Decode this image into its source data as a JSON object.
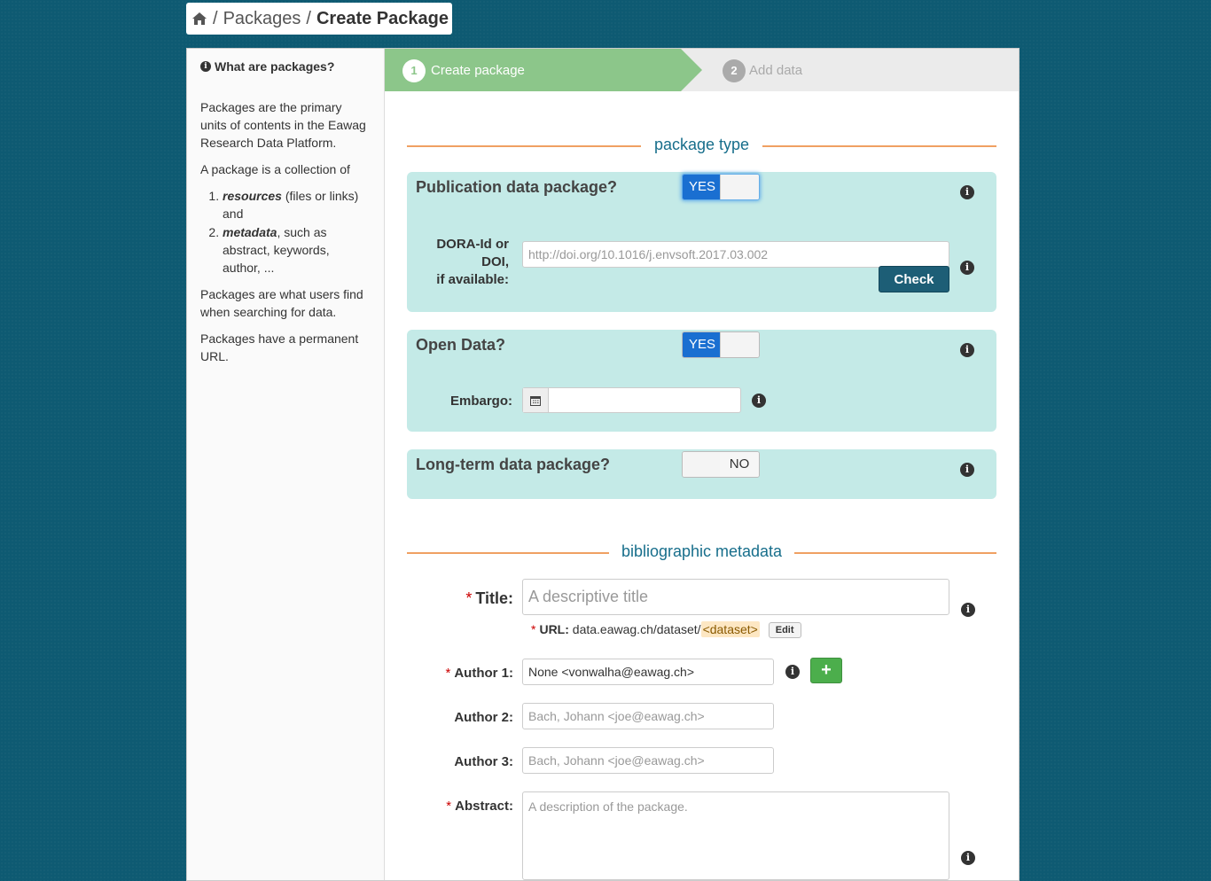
{
  "breadcrumb": {
    "home_icon": "home-icon",
    "sep": "/",
    "packages": "Packages",
    "current": "Create Package"
  },
  "sidebar": {
    "title": "What are packages?",
    "p1": "Packages are the primary units of contents in the Eawag Research Data Platform.",
    "p2": "A package is a collection of",
    "item1_em": "resources",
    "item1_rest": " (files or links) and",
    "item2_em": "metadata",
    "item2_rest": ", such as abstract, keywords, author, ...",
    "p3": "Packages are what users find when searching for data.",
    "p4": "Packages have a permanent URL."
  },
  "stages": {
    "s1_num": "1",
    "s1_label": "Create package",
    "s2_num": "2",
    "s2_label": "Add data"
  },
  "sections": {
    "package_type": "package type",
    "biblio": "bibliographic metadata"
  },
  "publication": {
    "title": "Publication data package?",
    "toggle": "YES",
    "doi_label_1": "DORA-Id or DOI,",
    "doi_label_2": "if available:",
    "doi_placeholder": "http://doi.org/10.1016/j.envsoft.2017.03.002",
    "check": "Check"
  },
  "open_data": {
    "title": "Open Data?",
    "toggle": "YES",
    "embargo_label": "Embargo:"
  },
  "longterm": {
    "title": "Long-term data package?",
    "toggle": "NO"
  },
  "fields": {
    "required_mark": "*",
    "title_label": "Title:",
    "title_placeholder": "A descriptive title",
    "url_label": "URL:",
    "url_base": "data.eawag.ch/dataset/",
    "url_slug": "<dataset>",
    "edit": "Edit",
    "author1_label": "Author 1:",
    "author1_value": "None <vonwalha@eawag.ch>",
    "add": "+",
    "author2_label": "Author 2:",
    "author2_placeholder": "Bach, Johann <joe@eawag.ch>",
    "author3_label": "Author 3:",
    "author3_placeholder": "Bach, Johann <joe@eawag.ch>",
    "abstract_label": "Abstract:",
    "abstract_placeholder": "A description of the package."
  },
  "info_glyph": "i",
  "colors": {
    "background": "#0e5a72",
    "stage_active": "#8cc68a",
    "panel": "#c4eae7",
    "accent_line": "#f0a062",
    "heading": "#176e8b",
    "toggle_on": "#1a6fd1",
    "check_button": "#1d5e76",
    "add_button": "#4cae4c"
  }
}
